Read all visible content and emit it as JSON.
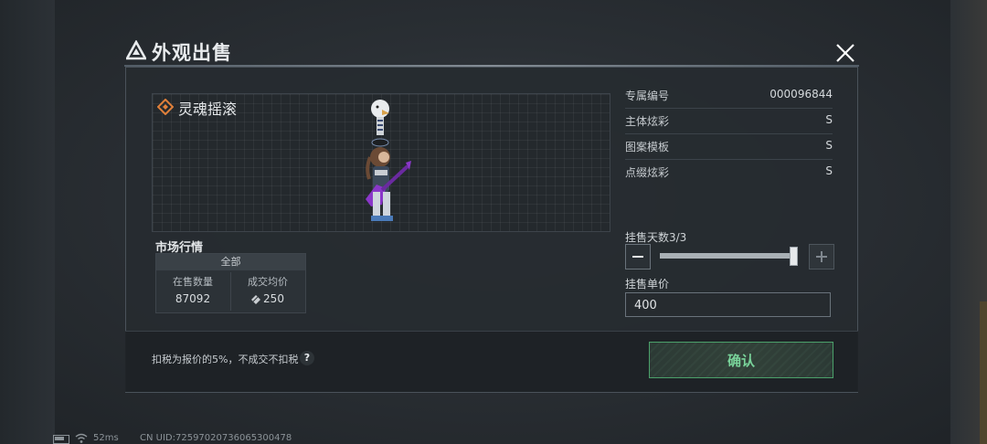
{
  "header": {
    "title": "外观出售"
  },
  "item": {
    "name": "灵魂摇滚"
  },
  "market": {
    "title": "市场行情",
    "filter": "全部",
    "on_sale_label": "在售数量",
    "on_sale_value": "87092",
    "avg_price_label": "成交均价",
    "avg_price_value": "250"
  },
  "info": [
    {
      "key": "专属编号",
      "value": "000096844"
    },
    {
      "key": "主体炫彩",
      "value": "S"
    },
    {
      "key": "图案模板",
      "value": "S"
    },
    {
      "key": "点缀炫彩",
      "value": "S"
    }
  ],
  "listing": {
    "days_label": "挂售天数3/3",
    "days_fraction": 1.0,
    "price_label": "挂售单价",
    "price_value": "400"
  },
  "footer": {
    "tax_note": "扣税为报价的5%，不成交不扣税",
    "help": "?",
    "confirm_label": "确认"
  },
  "status": {
    "ping": "52ms",
    "uid": "CN UID:72597020736065300478"
  },
  "colors": {
    "accent_green": "#79d39a",
    "item_icon": "#e0803a"
  },
  "icons": [
    "brand-logo-icon",
    "close-icon",
    "rarity-diamond-icon",
    "coin-icon",
    "help-icon",
    "battery-icon",
    "wifi-icon"
  ]
}
